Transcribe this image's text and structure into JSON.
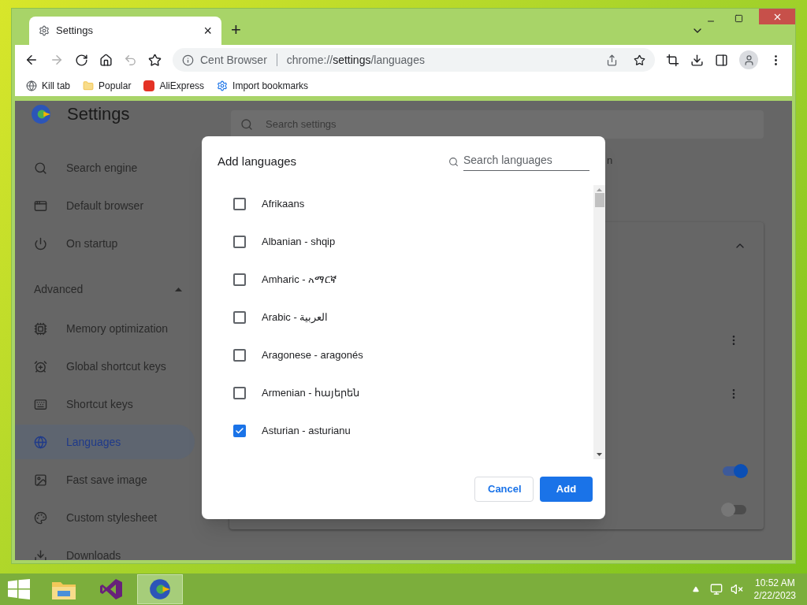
{
  "browser": {
    "tab": {
      "title": "Settings",
      "close": "×"
    },
    "new_tab": "+",
    "address": {
      "site": "Cent Browser",
      "url_prefix": "chrome://",
      "url_bold": "settings",
      "url_suffix": "/languages"
    },
    "bookmarks": [
      {
        "kind": "globe",
        "label": "Kill tab"
      },
      {
        "kind": "folder",
        "label": "Popular"
      },
      {
        "kind": "ali",
        "label": "AliExpress"
      },
      {
        "kind": "gear",
        "label": "Import bookmarks"
      }
    ]
  },
  "settings": {
    "title": "Settings",
    "search": {
      "placeholder": "Search settings"
    },
    "sidebar": [
      {
        "kind": "search",
        "label": "Search engine",
        "selected": false
      },
      {
        "kind": "browser",
        "label": "Default browser",
        "selected": false
      },
      {
        "kind": "power",
        "label": "On startup",
        "selected": false
      },
      {
        "kind": "section",
        "label": "Advanced",
        "expanded": true
      },
      {
        "kind": "chip",
        "label": "Memory optimization",
        "selected": false
      },
      {
        "kind": "alarm",
        "label": "Global shortcut keys",
        "selected": false
      },
      {
        "kind": "keyboard",
        "label": "Shortcut keys",
        "selected": false
      },
      {
        "kind": "globe",
        "label": "Languages",
        "selected": true
      },
      {
        "kind": "image",
        "label": "Fast save image",
        "selected": false
      },
      {
        "kind": "style",
        "label": "Custom stylesheet",
        "selected": false
      },
      {
        "kind": "download",
        "label": "Downloads",
        "selected": false
      }
    ],
    "partial_text": "n",
    "toggles": [
      {
        "on": true
      },
      {
        "on": false
      }
    ]
  },
  "dialog": {
    "title": "Add languages",
    "search": {
      "placeholder": "Search languages"
    },
    "languages": [
      {
        "label": "Afrikaans",
        "checked": false
      },
      {
        "label": "Albanian - shqip",
        "checked": false
      },
      {
        "label": "Amharic - አማርኛ",
        "checked": false
      },
      {
        "label": "Arabic - العربية",
        "checked": false
      },
      {
        "label": "Aragonese - aragonés",
        "checked": false
      },
      {
        "label": "Armenian - հայերեն",
        "checked": false
      },
      {
        "label": "Asturian - asturianu",
        "checked": true
      }
    ],
    "buttons": [
      {
        "kind": "secondary",
        "label": "Cancel"
      },
      {
        "kind": "primary",
        "label": "Add"
      }
    ]
  },
  "taskbar": {
    "clock": {
      "time": "10:52 AM",
      "date": "2/22/2023"
    }
  }
}
